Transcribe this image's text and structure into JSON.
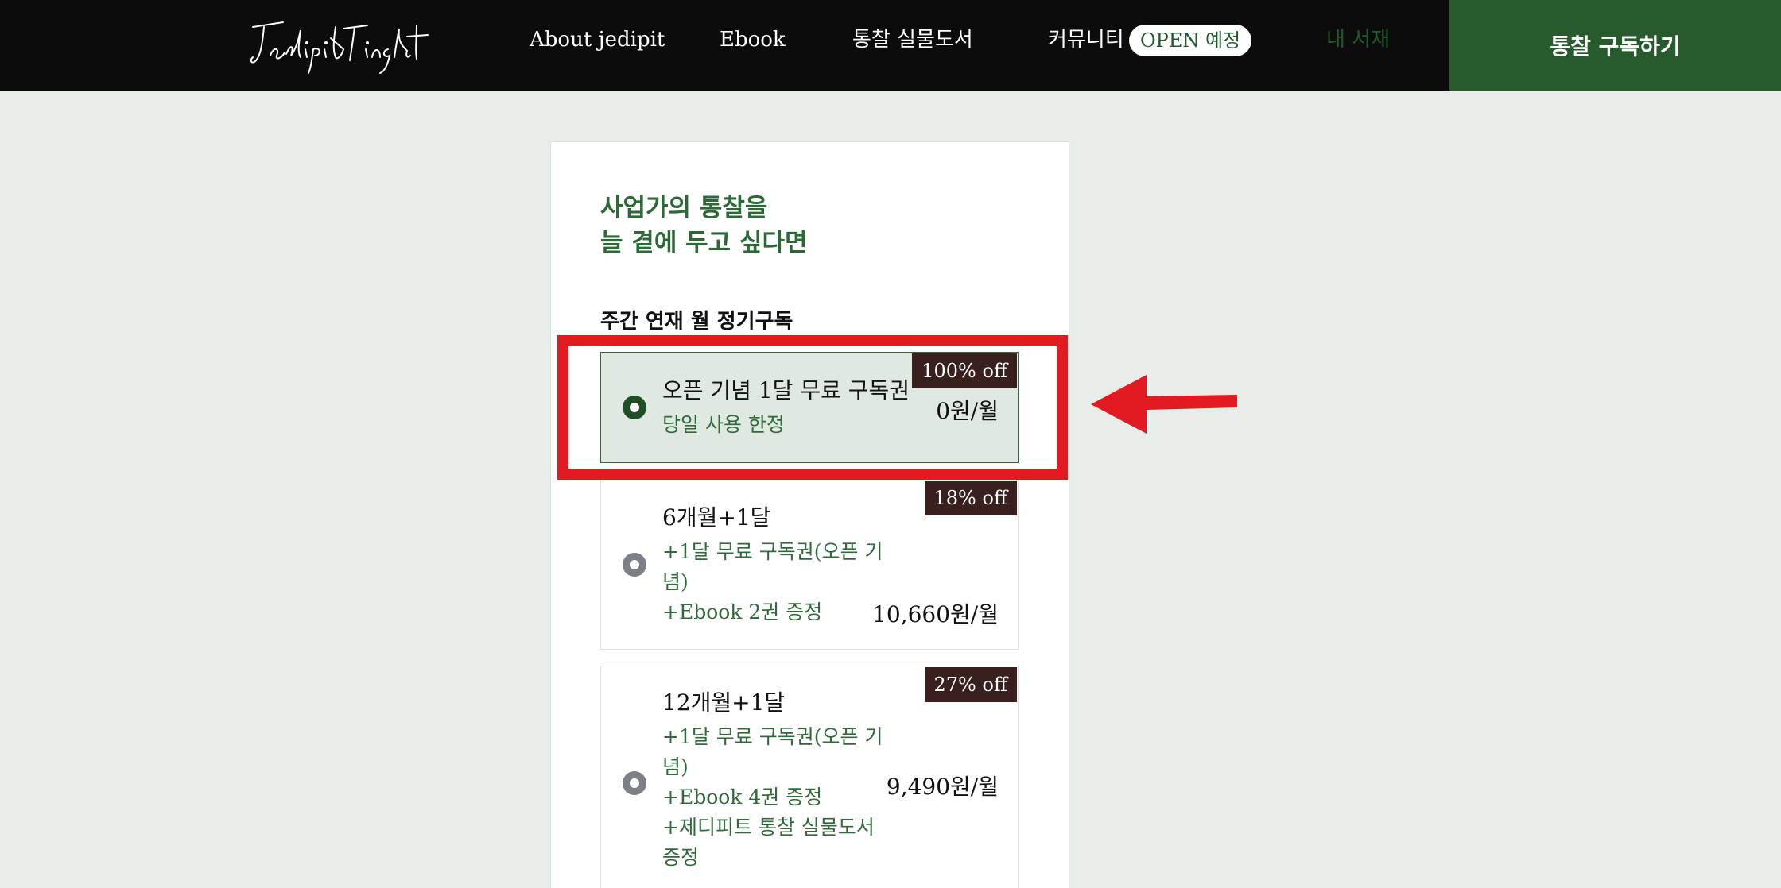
{
  "header": {
    "logo_text": "Jedipit Insight",
    "nav": {
      "about": "About jedipit",
      "ebook": "Ebook",
      "book": "통찰 실물도서",
      "community": "커뮤니티",
      "community_badge": "OPEN 예정",
      "library": "내 서재"
    },
    "cta": "통찰 구독하기"
  },
  "card": {
    "headline_line1": "사업가의 통찰을",
    "headline_line2": "늘 곁에 두고 싶다면",
    "section_label": "주간 연재 월 정기구독",
    "plans": [
      {
        "title": "오픈 기념 1달 무료 구독권",
        "sub": [
          "당일 사용 한정"
        ],
        "price": "0원/월",
        "discount": "100% off",
        "selected": true
      },
      {
        "title": "6개월+1달",
        "sub": [
          "+1달 무료 구독권(오픈 기념)",
          "+Ebook 2권 증정"
        ],
        "price": "10,660원/월",
        "discount": "18% off",
        "selected": false
      },
      {
        "title": "12개월+1달",
        "sub": [
          "+1달 무료 구독권(오픈 기념)",
          "+Ebook 4권 증정",
          "+제디피트 통찰 실물도서 증정"
        ],
        "price": "9,490원/월",
        "discount": "27% off",
        "selected": false
      }
    ]
  },
  "colors": {
    "header_bg": "#0c0c0c",
    "accent_green": "#275a2c",
    "selected_bg": "#dfe8e1",
    "discount_bg": "#3a1f1f",
    "annotation_red": "#e21b23"
  }
}
